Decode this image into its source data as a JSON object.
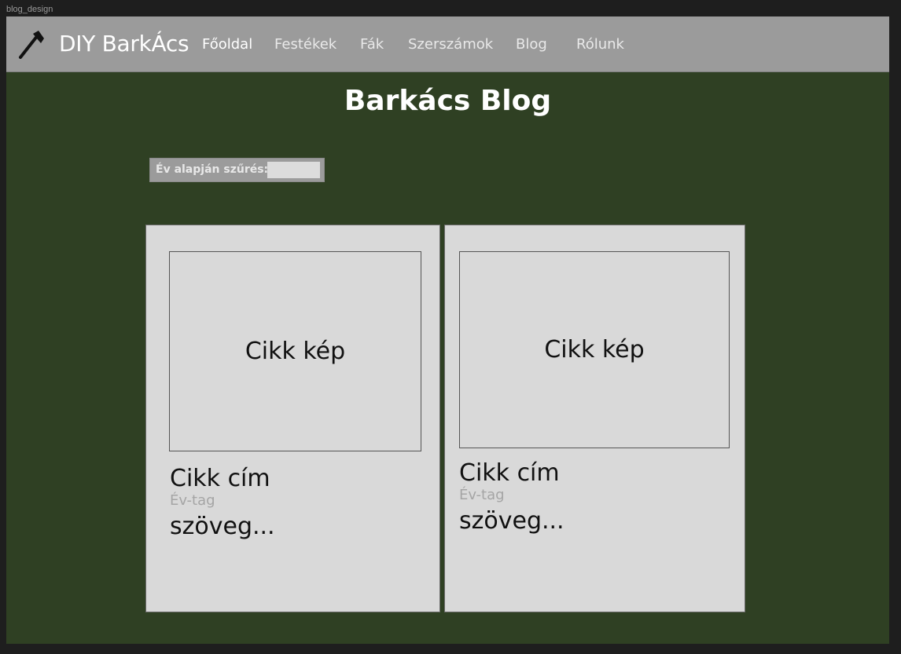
{
  "frame": {
    "label": "blog_design"
  },
  "navbar": {
    "brand": "DIY BarkÁcs",
    "brand_icon": "axe-icon",
    "items": [
      {
        "label": "Főoldal",
        "active": true
      },
      {
        "label": "Festékek",
        "active": false
      },
      {
        "label": "Fák",
        "active": false
      },
      {
        "label": "Szerszámok",
        "active": false
      },
      {
        "label": "Blog",
        "active": false
      },
      {
        "label": "Rólunk",
        "active": false
      }
    ]
  },
  "page": {
    "title": "Barkács Blog"
  },
  "filter": {
    "label": "Év alapján szűrés:",
    "value": ""
  },
  "cards": [
    {
      "image_label": "Cikk kép",
      "title": "Cikk cím",
      "tag": "Év-tag",
      "text": "szöveg..."
    },
    {
      "image_label": "Cikk kép",
      "title": "Cikk cím",
      "tag": "Év-tag",
      "text": "szöveg..."
    }
  ],
  "colors": {
    "background": "#2f4023",
    "navbar": "#9b9b9b",
    "card": "#d9d9d9",
    "tag_text": "#a5a5a5"
  }
}
